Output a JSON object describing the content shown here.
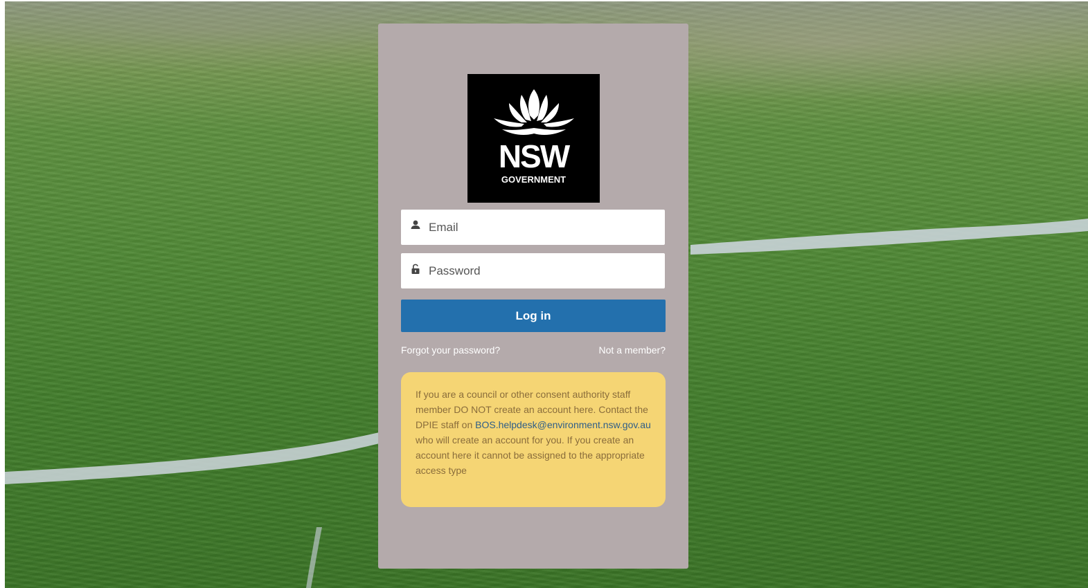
{
  "login": {
    "logo": {
      "word": "NSW",
      "subword": "GOVERNMENT",
      "emblem": "waratah-icon"
    },
    "email": {
      "placeholder": "Email",
      "value": "",
      "icon": "user-icon"
    },
    "password": {
      "placeholder": "Password",
      "value": "",
      "icon": "lock-icon"
    },
    "submit_label": "Log in",
    "forgot_label": "Forgot your password?",
    "signup_label": "Not a member?",
    "notice": {
      "text_before": "If you are a council or other consent authority staff member DO NOT create an account here. Contact the DPIE staff on ",
      "email_link": "BOS.helpdesk@environment.nsw.gov.au",
      "text_after": " who will create an account for you. If you create an account here it cannot be assigned to the appropriate access type"
    }
  },
  "colors": {
    "card": "#b4aaab",
    "button": "#2370ad",
    "notice_bg": "#f5d574",
    "notice_text": "#8a6d3b",
    "link": "#2f5e88"
  }
}
